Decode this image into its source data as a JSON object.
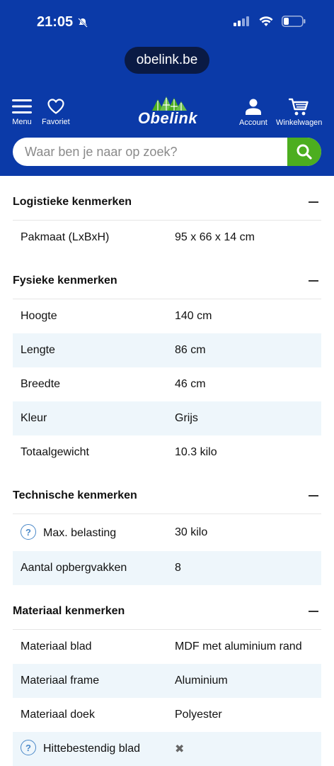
{
  "status": {
    "time": "21:05"
  },
  "browser": {
    "url": "obelink.be"
  },
  "nav": {
    "menu_label": "Menu",
    "favorites_label": "Favoriet",
    "logo_text": "Obelink",
    "account_label": "Account",
    "cart_label": "Winkelwagen"
  },
  "search": {
    "placeholder": "Waar ben je naar op zoek?"
  },
  "colors": {
    "brand_blue": "#0b3aa8",
    "search_green": "#4cae1f",
    "row_alt": "#eef6fb"
  },
  "sections": [
    {
      "title": "Logistieke kenmerken",
      "rows": [
        {
          "label": "Pakmaat (LxBxH)",
          "value": "95 x 66 x 14 cm"
        }
      ]
    },
    {
      "title": "Fysieke kenmerken",
      "rows": [
        {
          "label": "Hoogte",
          "value": "140 cm"
        },
        {
          "label": "Lengte",
          "value": "86 cm"
        },
        {
          "label": "Breedte",
          "value": "46 cm"
        },
        {
          "label": "Kleur",
          "value": "Grijs"
        },
        {
          "label": "Totaalgewicht",
          "value": "10.3 kilo"
        }
      ]
    },
    {
      "title": "Technische kenmerken",
      "rows": [
        {
          "label": "Max. belasting",
          "value": "30 kilo"
        },
        {
          "label": "Aantal opbergvakken",
          "value": "8"
        }
      ]
    },
    {
      "title": "Materiaal kenmerken",
      "rows": [
        {
          "label": "Materiaal blad",
          "value": "MDF met aluminium rand"
        },
        {
          "label": "Materiaal frame",
          "value": "Aluminium"
        },
        {
          "label": "Materiaal doek",
          "value": "Polyester"
        },
        {
          "label": "Hittebestendig blad",
          "value": "✖"
        }
      ]
    }
  ]
}
